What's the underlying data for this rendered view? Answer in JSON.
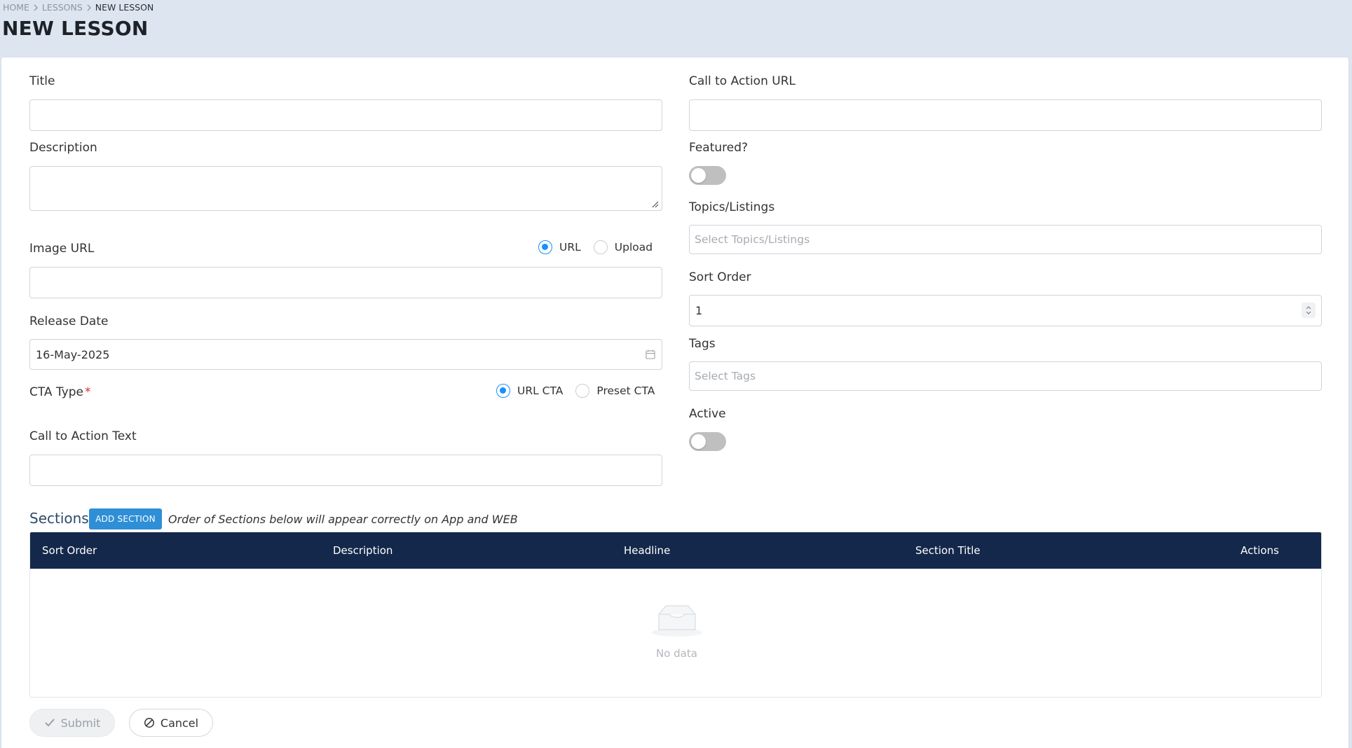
{
  "breadcrumb": {
    "home": "HOME",
    "lessons": "LESSONS",
    "current": "NEW LESSON"
  },
  "page_title": "NEW LESSON",
  "form": {
    "title_label": "Title",
    "title_value": "",
    "description_label": "Description",
    "description_value": "",
    "image_url_label": "Image URL",
    "image_source": {
      "options": [
        "URL",
        "Upload"
      ],
      "selected": "URL"
    },
    "image_url_value": "",
    "release_date_label": "Release Date",
    "release_date_value": "16-May-2025",
    "cta_type_label": "CTA Type",
    "cta_type_required_mark": "*",
    "cta_type": {
      "options": [
        "URL CTA",
        "Preset CTA"
      ],
      "selected": "URL CTA"
    },
    "cta_text_label": "Call to Action Text",
    "cta_text_value": "",
    "cta_url_label": "Call to Action URL",
    "cta_url_value": "",
    "featured_label": "Featured?",
    "featured_on": false,
    "topics_label": "Topics/Listings",
    "topics_placeholder": "Select Topics/Listings",
    "sort_order_label": "Sort Order",
    "sort_order_value": "1",
    "tags_label": "Tags",
    "tags_placeholder": "Select Tags",
    "active_label": "Active",
    "active_on": false
  },
  "sections": {
    "title": "Sections",
    "add_button": "ADD SECTION",
    "note": "Order of Sections below will appear correctly on App and WEB",
    "columns": [
      "Sort Order",
      "Description",
      "Headline",
      "Section Title",
      "Actions"
    ],
    "rows": [],
    "empty_text": "No data"
  },
  "actions": {
    "submit": "Submit",
    "cancel": "Cancel"
  },
  "colors": {
    "header": "#14284b",
    "accent": "#1890ff",
    "add_button": "#2f8fd6",
    "page_bg": "#dde6f0"
  },
  "icons": [
    "chevron-right-icon",
    "calendar-icon",
    "resize-grip-icon",
    "stepper-icon",
    "inbox-empty-icon",
    "check-icon",
    "cancel-icon"
  ]
}
